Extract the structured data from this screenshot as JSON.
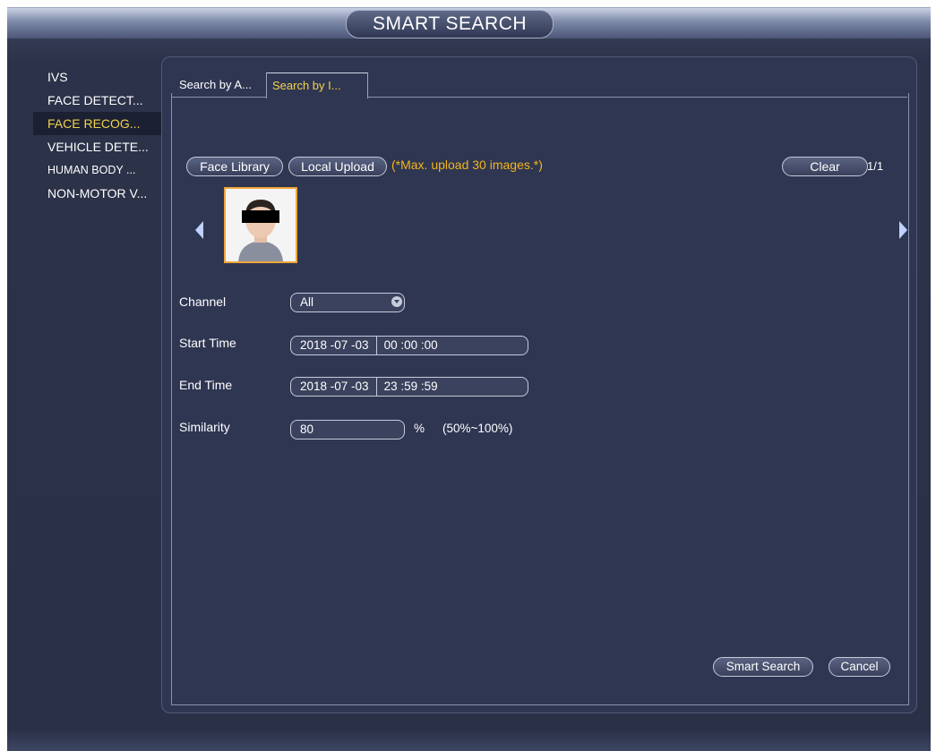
{
  "window": {
    "title": "SMART SEARCH"
  },
  "sidebar": {
    "items": [
      {
        "label": "IVS"
      },
      {
        "label": "FACE DETECT..."
      },
      {
        "label": "FACE RECOG..."
      },
      {
        "label": "VEHICLE DETE..."
      },
      {
        "label": "HUMAN BODY ..."
      },
      {
        "label": "NON-MOTOR V..."
      }
    ],
    "active_index": 2
  },
  "tabs": [
    {
      "label": "Search by A..."
    },
    {
      "label": "Search by I..."
    }
  ],
  "toolbar": {
    "face_library": "Face Library",
    "local_upload": "Local Upload",
    "note": "(*Max. upload 30 images.*)",
    "clear": "Clear",
    "page": "1/1"
  },
  "form": {
    "channel_label": "Channel",
    "channel_value": "All",
    "start_label": "Start Time",
    "start_date": "2018 -07 -03",
    "start_time": "00 :00 :00",
    "end_label": "End Time",
    "end_date": "2018 -07 -03",
    "end_time": "23 :59 :59",
    "similarity_label": "Similarity",
    "similarity_value": "80",
    "similarity_unit": "%",
    "similarity_range": "(50%~100%)"
  },
  "actions": {
    "smart_search": "Smart Search",
    "cancel": "Cancel"
  },
  "colors": {
    "accent_yellow": "#f2d34a",
    "note_orange": "#f4b41a",
    "panel_bg": "#2f3652",
    "thumb_border": "#f0a63a"
  },
  "icons": {
    "prev": "chevron-left-icon",
    "next": "chevron-right-icon",
    "dropdown": "dropdown-arrow-icon"
  }
}
